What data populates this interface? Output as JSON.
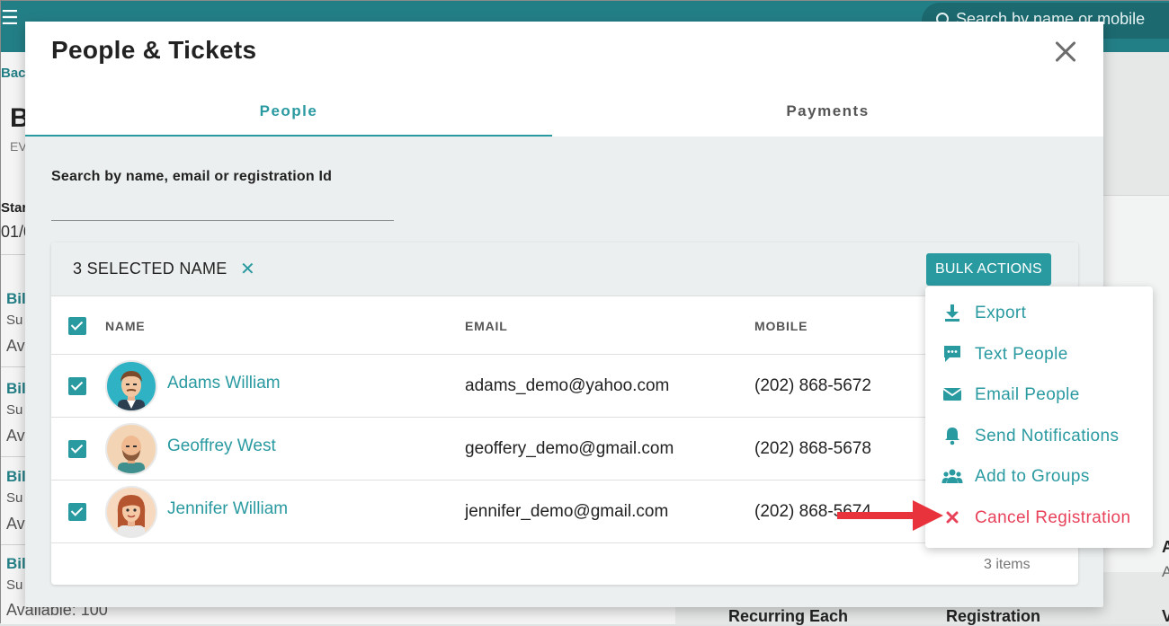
{
  "background": {
    "search_placeholder": "Search by name or mobile",
    "back_link": "Back",
    "page_title_initial": "B",
    "page_sub_initial": "EV",
    "start_label": "Star",
    "start_value": "01/0",
    "list_items": [
      {
        "title": "Bil",
        "sub": "Su",
        "avail": "Av"
      },
      {
        "title": "Bil",
        "sub": "Su",
        "avail": "Av"
      },
      {
        "title": "Bil",
        "sub": "Su",
        "avail": "Av"
      },
      {
        "title": "Bil",
        "sub": "Su",
        "avail": "Available: 100"
      }
    ],
    "right_bottom_1": "Recurring Each",
    "right_bottom_2": "Registration",
    "right_bottom_3": "V",
    "right_side_a1": "A",
    "right_side_a2": "A"
  },
  "modal": {
    "title": "People & Tickets",
    "tabs": [
      {
        "label": "People",
        "active": true
      },
      {
        "label": "Payments",
        "active": false
      }
    ],
    "search_label": "Search by name, email or registration Id",
    "search_value": ""
  },
  "table": {
    "selected_text": "3 SELECTED NAME",
    "clear_symbol": "✕",
    "bulk_actions_label": "BULK ACTIONS",
    "columns": {
      "name": "NAME",
      "email": "EMAIL",
      "mobile": "MOBILE"
    },
    "rows": [
      {
        "name": "Adams William",
        "email": "adams_demo@yahoo.com",
        "mobile": "(202) 868-5672",
        "checked": true
      },
      {
        "name": "Geoffrey West",
        "email": "geoffery_demo@gmail.com",
        "mobile": "(202) 868-5678",
        "checked": true
      },
      {
        "name": "Jennifer William",
        "email": "jennifer_demo@gmail.com",
        "mobile": "(202) 868-5674",
        "checked": true
      }
    ],
    "footer_count": "3 items"
  },
  "bulk_menu": {
    "items": [
      {
        "label": "Export",
        "icon": "download-icon"
      },
      {
        "label": "Text People",
        "icon": "chat-icon"
      },
      {
        "label": "Email People",
        "icon": "envelope-icon"
      },
      {
        "label": "Send Notifications",
        "icon": "bell-icon"
      },
      {
        "label": "Add to Groups",
        "icon": "group-icon"
      },
      {
        "label": "Cancel Registration",
        "icon": "x-icon"
      }
    ]
  },
  "colors": {
    "accent": "#2a9aa1",
    "topbar": "#237f86",
    "danger": "#e8415a",
    "arrow": "#e8323c"
  }
}
